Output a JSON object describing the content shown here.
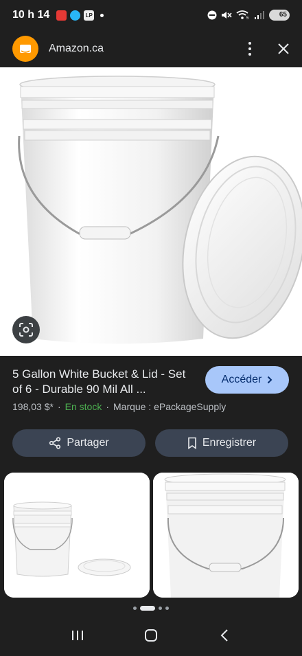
{
  "status_bar": {
    "time": "10 h 14",
    "lp_label": "LP",
    "wifi_label": "5",
    "battery": "65"
  },
  "header": {
    "site": "Amazon.ca"
  },
  "product": {
    "title": "5 Gallon White Bucket & Lid - Set of 6 - Durable 90 Mil All ...",
    "access_label": "Accéder",
    "price": "198,03 $*",
    "separator": "·",
    "stock": "En stock",
    "brand": "Marque : ePackageSupply"
  },
  "actions": {
    "share_label": "Partager",
    "save_label": "Enregistrer"
  },
  "pager": {
    "active_index": 1,
    "count": 4
  },
  "colors": {
    "background": "#1f1f1f",
    "accent_button": "#a8c7fa",
    "pill_button": "#3b4453",
    "stock_green": "#4caf50",
    "amazon_orange": "#ff9900"
  }
}
